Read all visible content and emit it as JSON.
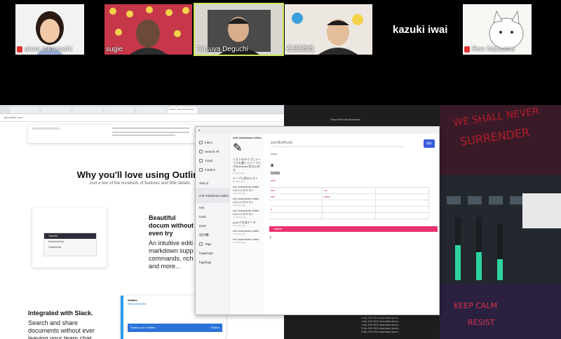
{
  "participants": [
    {
      "name": "anna takanashi",
      "muted": true
    },
    {
      "name": "sugie",
      "muted": false
    },
    {
      "name": "Tatsuya Deguchi",
      "muted": false,
      "speaking": true
    },
    {
      "name": "石田道識",
      "muted": false
    },
    {
      "name": "kazuki iwai",
      "video": false
    },
    {
      "name": "Ren Natsume",
      "muted": true
    }
  ],
  "browser": {
    "tabs": [
      "",
      "",
      "",
      "",
      "",
      "Outline - Team Documents"
    ],
    "url": "getoutline.com",
    "hero_title": "Why you'll love using Outline",
    "hero_subtitle": "Just a few of the hundreds of features and little details.",
    "feature1_title": "Beautiful docum without even try",
    "feature1_body": "An intuitive editi markdown supp commands, rich and more...",
    "feature2_title": "Integrated with Slack.",
    "feature2_body": "Search and share documents without ever leaving your team chat.",
    "slack_card": {
      "app": "Outline",
      "item1": "Brand Inspiration",
      "item2": "Search your Outline",
      "label": "Outline"
    },
    "menu_items": [
      "Todo list",
      "Numbered list",
      "Ordered list"
    ]
  },
  "outline_app": {
    "nav": [
      "Inbox",
      "Search All",
      "Trash",
      "Folders"
    ],
    "docs": [
      "start.js",
      "rich-markdown-editor",
      "test",
      "test2",
      "test3",
      "日付種",
      "Tags",
      "hogehoge",
      "fugafuge"
    ],
    "list": [
      {
        "title": "rich-markdown-editor",
        "meta": ""
      },
      {
        "title": "リストのタイプにテーブルを書くとテーブルがMarkdown形式に戻る",
        "meta": "10 days ago"
      },
      {
        "title": "テーブル表のテスト",
        "meta": "10 days ago"
      },
      {
        "title": "rich-markdown-editor v10.0.0 のテスト",
        "meta": "4 months ago"
      },
      {
        "title": "rich-markdown-editor v10.0.0 のテスト",
        "meta": "4 months ago"
      },
      {
        "title": "rich-markdown-editor v10.0.0 のテスト",
        "meta": "4 months ago"
      },
      {
        "title": "pushで生成データ",
        "meta": "4 months ago"
      },
      {
        "title": "rich-markdown-editor",
        "meta": "4 months ago"
      },
      {
        "title": "rich-markdown-editor",
        "meta": "4 months ago"
      }
    ],
    "doc_title": "2020年9月15日",
    "doc_text": [
      "aaaa",
      "a",
      "bbbb",
      "aaa"
    ],
    "table": [
      [
        "aaa",
        "aa",
        ""
      ],
      [
        "aaa",
        "aaaa",
        ""
      ],
      [
        "",
        "",
        ""
      ],
      [
        "a",
        "",
        ""
      ],
      [
        "",
        "",
        ""
      ]
    ],
    "highlight_text": "editable",
    "save_button": "保存"
  },
  "dark_pane": {
    "header": "Show Remote Branches",
    "rows": [
      "3 Sep 2020 08:04   dependabot previo...",
      "3 Sep 2020 08:04   dependabot previo...",
      "3 Sep 2020 08:04   dependabot previo...",
      "4 Sep 2020 08:04   dependabot previo...",
      "4 Sep 2020 08:04   dependabot previo...",
      "5 Sep 2020 08:04   dependabot previo...",
      "5 Sep 2020 08:04   dependabot previo..."
    ]
  },
  "colors": {
    "accent": "#e8336f",
    "speaking": "#c8e85a",
    "save": "#3b5bdb"
  }
}
